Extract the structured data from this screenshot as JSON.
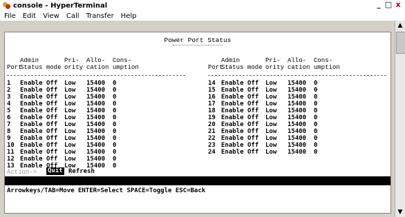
{
  "window": {
    "title": "console - HyperTerminal",
    "controls": {
      "minimize": "_",
      "maximize": "□",
      "close": "x"
    }
  },
  "menu": [
    "File",
    "Edit",
    "View",
    "Call",
    "Transfer",
    "Help"
  ],
  "terminal": {
    "title": "Power Port Status",
    "title_rule": "*****************",
    "headers_line1": [
      "",
      "Admin",
      "",
      "Pri-",
      "Allo-",
      "Cons-"
    ],
    "headers_line2": [
      "Port",
      "Status",
      "mode",
      "ority",
      "cation",
      "umption"
    ],
    "left_rows": [
      [
        "1",
        "Enable",
        "Off",
        "Low",
        "15400",
        "0"
      ],
      [
        "2",
        "Enable",
        "Off",
        "Low",
        "15400",
        "0"
      ],
      [
        "3",
        "Enable",
        "Off",
        "Low",
        "15400",
        "0"
      ],
      [
        "4",
        "Enable",
        "Off",
        "Low",
        "15400",
        "0"
      ],
      [
        "5",
        "Enable",
        "Off",
        "Low",
        "15400",
        "0"
      ],
      [
        "6",
        "Enable",
        "Off",
        "Low",
        "15400",
        "0"
      ],
      [
        "7",
        "Enable",
        "Off",
        "Low",
        "15400",
        "0"
      ],
      [
        "8",
        "Enable",
        "Off",
        "Low",
        "15400",
        "0"
      ],
      [
        "9",
        "Enable",
        "Off",
        "Low",
        "15400",
        "0"
      ],
      [
        "10",
        "Enable",
        "Off",
        "Low",
        "15400",
        "0"
      ],
      [
        "11",
        "Enable",
        "Off",
        "Low",
        "15400",
        "0"
      ],
      [
        "12",
        "Enable",
        "Off",
        "Low",
        "15400",
        "0"
      ],
      [
        "13",
        "Enable",
        "Off",
        "Low",
        "15400",
        "0"
      ]
    ],
    "right_rows": [
      [
        "14",
        "Enable",
        "Off",
        "Low",
        "15400",
        "0"
      ],
      [
        "15",
        "Enable",
        "Off",
        "Low",
        "15400",
        "0"
      ],
      [
        "16",
        "Enable",
        "Off",
        "Low",
        "15400",
        "0"
      ],
      [
        "17",
        "Enable",
        "Off",
        "Low",
        "15400",
        "0"
      ],
      [
        "18",
        "Enable",
        "Off",
        "Low",
        "15400",
        "0"
      ],
      [
        "19",
        "Enable",
        "Off",
        "Low",
        "15400",
        "0"
      ],
      [
        "20",
        "Enable",
        "Off",
        "Low",
        "15400",
        "0"
      ],
      [
        "21",
        "Enable",
        "Off",
        "Low",
        "15400",
        "0"
      ],
      [
        "22",
        "Enable",
        "Off",
        "Low",
        "15400",
        "0"
      ],
      [
        "23",
        "Enable",
        "Off",
        "Low",
        "15400",
        "0"
      ],
      [
        "24",
        "Enable",
        "Off",
        "Low",
        "15400",
        "0"
      ]
    ],
    "action_label": "Action->",
    "actions": {
      "quit": "Quit",
      "refresh": "Refresh"
    },
    "help_line": "Arrowkeys/TAB=Move  ENTER=Select  SPACE=Toggle  ESC=Back"
  },
  "colors": {
    "frame": "#d4d0c8",
    "terminal_bg": "#ffffff",
    "terminal_text": "#000000",
    "highlight_bg": "#000000",
    "highlight_text": "#ffffff"
  },
  "scrollbar": {
    "up": "▲",
    "down": "▼"
  }
}
